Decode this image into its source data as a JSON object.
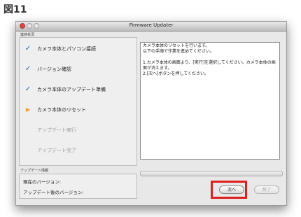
{
  "figure_label": "図11",
  "window": {
    "title": "Firmware Updater"
  },
  "steps_section": {
    "label": "進捗状況",
    "items": [
      {
        "label": "カメラ本体とパソコン接続",
        "state": "done",
        "icon": "checkmark-icon",
        "symbol": "✓"
      },
      {
        "label": "バージョン確認",
        "state": "done",
        "icon": "checkmark-icon",
        "symbol": "✓"
      },
      {
        "label": "カメラ本体のアップデート準備",
        "state": "done",
        "icon": "checkmark-icon",
        "symbol": "✓"
      },
      {
        "label": "カメラ本体のリセット",
        "state": "current",
        "icon": "current-step-arrow-icon",
        "symbol": "▶"
      },
      {
        "label": "アップデート実行",
        "state": "pending",
        "icon": "",
        "symbol": ""
      },
      {
        "label": "アップデート完了",
        "state": "pending",
        "icon": "",
        "symbol": ""
      }
    ]
  },
  "message": {
    "lines": [
      "カメラ本体のリセットを行います。",
      "以下の手順で作業を進めてください。",
      "",
      "1.カメラ本体の画面より、[実行]を選択してください。カメラ本体の画",
      "面が消えます。",
      "2.[次へ]ボタンを押してください。"
    ]
  },
  "update_info": {
    "label": "アップデート情報",
    "current_version_label": "現在のバージョン:",
    "after_version_label": "アップデート後のバージョン:"
  },
  "buttons": {
    "next_label": "次へ",
    "finish_label": "終了"
  },
  "colors": {
    "check": "#2c5fa8",
    "current_arrow": "#ff9a1a",
    "highlight": "#e02020"
  }
}
